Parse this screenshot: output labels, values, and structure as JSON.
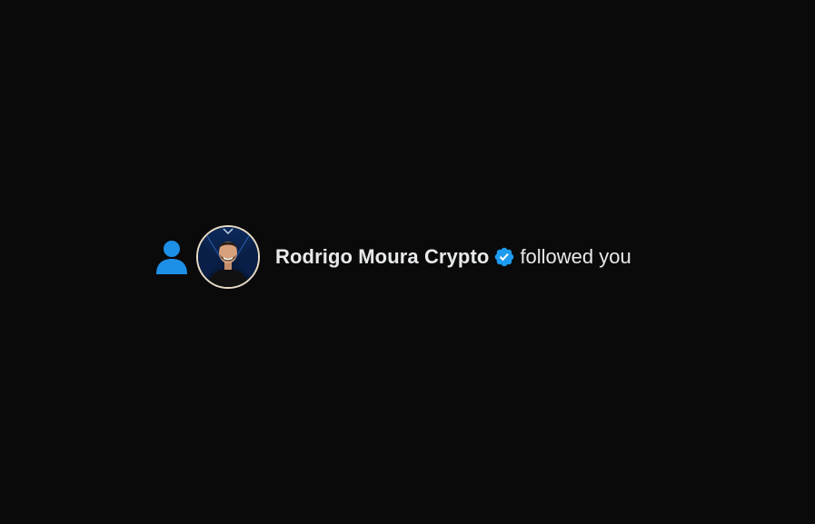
{
  "notification": {
    "type_icon": "person-icon",
    "avatar_icon": "user-avatar",
    "user_name": "Rodrigo Moura Crypto",
    "verified_icon": "verified-badge-icon",
    "action_text": "followed you"
  },
  "colors": {
    "background": "#0a0a0b",
    "accent_blue": "#1d9bf0",
    "text": "#e7e9ea",
    "avatar_border": "#e8dcc4"
  }
}
